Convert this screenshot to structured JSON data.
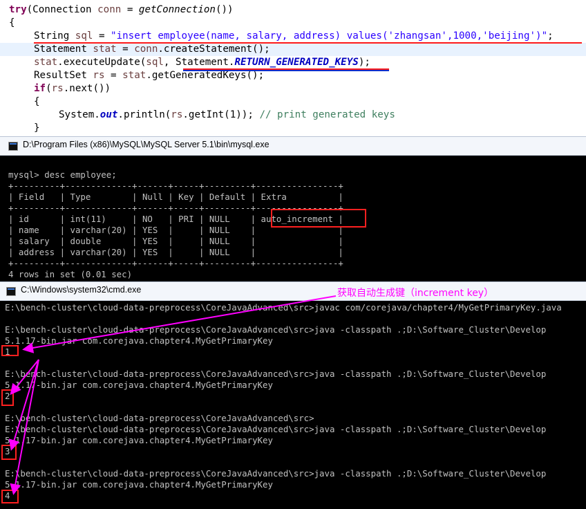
{
  "code": {
    "line_try": [
      "try",
      "(Connection ",
      "conn",
      " = ",
      "getConnection",
      "())"
    ],
    "line_brace_open": "{",
    "line_sql": [
      "String ",
      "sql",
      " = ",
      "\"insert employee(name, salary, address) values('zhangsan',1000,'beijing')\"",
      ";"
    ],
    "line_stmt": [
      "Statement ",
      "stat",
      " = ",
      "conn",
      ".createStatement();"
    ],
    "line_exec": [
      "stat",
      ".executeUpdate(",
      "sql",
      ", ",
      "Statement.",
      "RETURN_GENERATED_KEYS",
      ");"
    ],
    "line_rs": [
      "ResultSet ",
      "rs",
      " = ",
      "stat",
      ".getGeneratedKeys();"
    ],
    "line_if": [
      "if",
      "(",
      "rs",
      ".next())"
    ],
    "line_brace2": "{",
    "line_print": [
      "System.",
      "out",
      ".println(",
      "rs",
      ".getInt(1)); ",
      "// print generated keys"
    ],
    "line_brace_close": "}"
  },
  "mysql_window": {
    "title": "D:\\Program Files (x86)\\MySQL\\MySQL Server 5.1\\bin\\mysql.exe",
    "lines": [
      "mysql> desc employee;",
      "+---------+-------------+------+-----+---------+----------------+",
      "| Field   | Type        | Null | Key | Default | Extra          |",
      "+---------+-------------+------+-----+---------+----------------+",
      "| id      | int(11)     | NO   | PRI | NULL    | auto_increment |",
      "| name    | varchar(20) | YES  |     | NULL    |                |",
      "| salary  | double      | YES  |     | NULL    |                |",
      "| address | varchar(20) | YES  |     | NULL    |                |",
      "+---------+-------------+------+-----+---------+----------------+",
      "4 rows in set (0.01 sec)"
    ]
  },
  "cmd_window": {
    "title": "C:\\Windows\\system32\\cmd.exe",
    "lines": [
      "E:\\bench-cluster\\cloud-data-preprocess\\CoreJavaAdvanced\\src>javac com/corejava/chapter4/MyGetPrimaryKey.java",
      "",
      "E:\\bench-cluster\\cloud-data-preprocess\\CoreJavaAdvanced\\src>java -classpath .;D:\\Software_Cluster\\Develop",
      "5.1.17-bin.jar com.corejava.chapter4.MyGetPrimaryKey",
      "1",
      "",
      "",
      "E:\\bench-cluster\\cloud-data-preprocess\\CoreJavaAdvanced\\src>java -classpath .;D:\\Software_Cluster\\Develop",
      "5.1.17-bin.jar com.corejava.chapter4.MyGetPrimaryKey",
      "2",
      "",
      "E:\\bench-cluster\\cloud-data-preprocess\\CoreJavaAdvanced\\src>",
      "E:\\bench-cluster\\cloud-data-preprocess\\CoreJavaAdvanced\\src>java -classpath .;D:\\Software_Cluster\\Develop",
      "5.1.17-bin.jar com.corejava.chapter4.MyGetPrimaryKey",
      "3",
      "",
      "E:\\bench-cluster\\cloud-data-preprocess\\CoreJavaAdvanced\\src>java -classpath .;D:\\Software_Cluster\\Develop",
      "5.1.17-bin.jar com.corejava.chapter4.MyGetPrimaryKey",
      "4"
    ]
  },
  "annotation": {
    "text": "获取自动生成键（increment key）",
    "color": "#ff00ff"
  },
  "colors": {
    "highlight_box": "#ff2020",
    "console_bg": "#000000",
    "console_text": "#c0c0c0"
  }
}
